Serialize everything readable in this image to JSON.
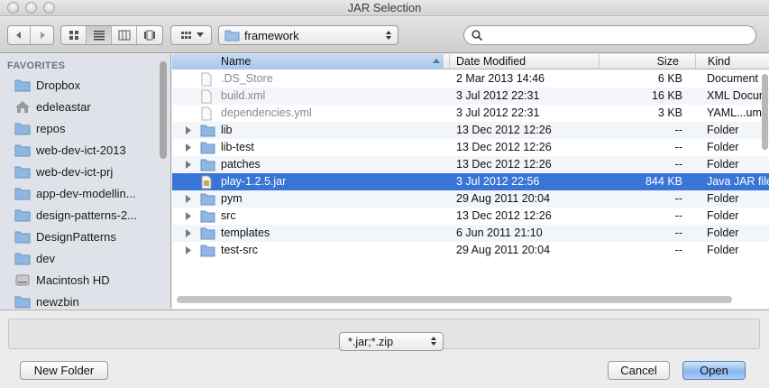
{
  "window": {
    "title": "JAR Selection"
  },
  "toolbar": {
    "nav_icons": [
      "back-arrow-icon",
      "forward-arrow-icon"
    ],
    "view_modes": [
      "icon-view-icon",
      "list-view-icon",
      "column-view-icon",
      "coverflow-view-icon"
    ],
    "active_view": "list",
    "arrange_icon": "arrange-grid-icon",
    "location": "framework",
    "search_placeholder": ""
  },
  "sidebar": {
    "heading": "FAVORITES",
    "items": [
      {
        "label": "Dropbox",
        "icon": "folder-icon"
      },
      {
        "label": "edeleastar",
        "icon": "home-icon"
      },
      {
        "label": "repos",
        "icon": "folder-icon"
      },
      {
        "label": "web-dev-ict-2013",
        "icon": "folder-icon"
      },
      {
        "label": "web-dev-ict-prj",
        "icon": "folder-icon"
      },
      {
        "label": "app-dev-modellin...",
        "icon": "folder-icon"
      },
      {
        "label": "design-patterns-2...",
        "icon": "folder-icon"
      },
      {
        "label": "DesignPatterns",
        "icon": "folder-icon"
      },
      {
        "label": "dev",
        "icon": "folder-icon"
      },
      {
        "label": "Macintosh HD",
        "icon": "harddisk-icon"
      },
      {
        "label": "newzbin",
        "icon": "folder-icon"
      }
    ]
  },
  "columns": {
    "name": "Name",
    "date": "Date Modified",
    "size": "Size",
    "kind": "Kind"
  },
  "files": [
    {
      "name": ".DS_Store",
      "date": "2 Mar 2013 14:46",
      "size": "6 KB",
      "kind": "Document",
      "type": "file",
      "enabled": false
    },
    {
      "name": "build.xml",
      "date": "3 Jul 2012 22:31",
      "size": "16 KB",
      "kind": "XML Docum",
      "type": "file",
      "enabled": false
    },
    {
      "name": "dependencies.yml",
      "date": "3 Jul 2012 22:31",
      "size": "3 KB",
      "kind": "YAML...ume",
      "type": "file",
      "enabled": false
    },
    {
      "name": "lib",
      "date": "13 Dec 2012 12:26",
      "size": "--",
      "kind": "Folder",
      "type": "folder",
      "enabled": true
    },
    {
      "name": "lib-test",
      "date": "13 Dec 2012 12:26",
      "size": "--",
      "kind": "Folder",
      "type": "folder",
      "enabled": true
    },
    {
      "name": "patches",
      "date": "13 Dec 2012 12:26",
      "size": "--",
      "kind": "Folder",
      "type": "folder",
      "enabled": true
    },
    {
      "name": "play-1.2.5.jar",
      "date": "3 Jul 2012 22:56",
      "size": "844 KB",
      "kind": "Java JAR file",
      "type": "jar",
      "enabled": true,
      "selected": true
    },
    {
      "name": "pym",
      "date": "29 Aug 2011 20:04",
      "size": "--",
      "kind": "Folder",
      "type": "folder",
      "enabled": true
    },
    {
      "name": "src",
      "date": "13 Dec 2012 12:26",
      "size": "--",
      "kind": "Folder",
      "type": "folder",
      "enabled": true
    },
    {
      "name": "templates",
      "date": "6 Jun 2011 21:10",
      "size": "--",
      "kind": "Folder",
      "type": "folder",
      "enabled": true
    },
    {
      "name": "test-src",
      "date": "29 Aug 2011 20:04",
      "size": "--",
      "kind": "Folder",
      "type": "folder",
      "enabled": true
    }
  ],
  "filter": {
    "selected": "*.jar;*.zip"
  },
  "buttons": {
    "new_folder": "New Folder",
    "cancel": "Cancel",
    "open": "Open"
  },
  "colors": {
    "selection": "#3875d7",
    "sidebar_bg": "#dfe3e9",
    "folder": "#8fb7e3",
    "default_button": "#8ab8f1"
  }
}
